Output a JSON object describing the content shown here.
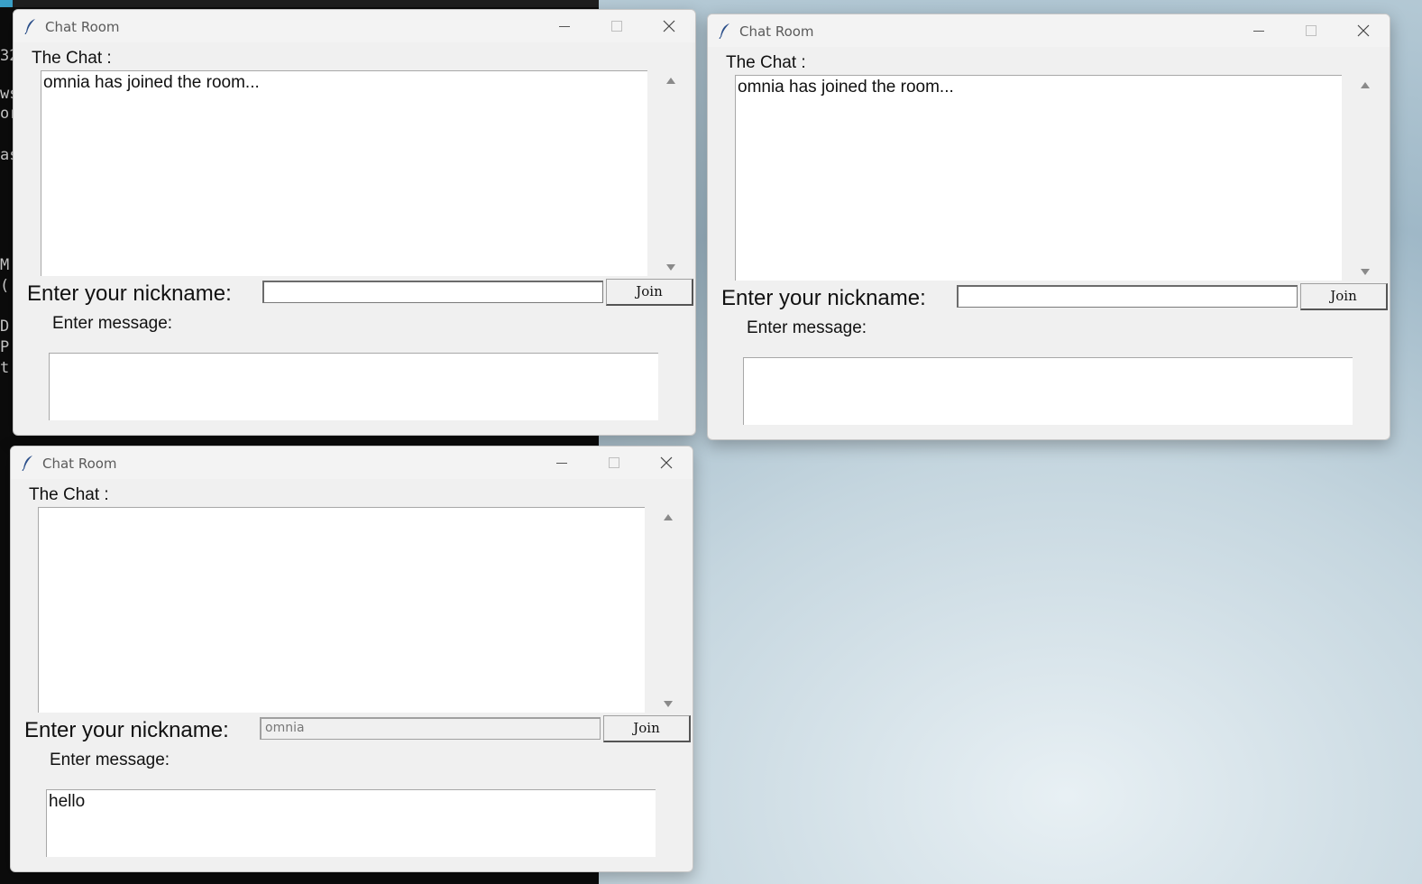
{
  "desktop": {
    "terminal_lines": [
      "32",
      "ws",
      "or",
      "",
      "as",
      "",
      "",
      "",
      "",
      "",
      "",
      "",
      "",
      "",
      "M",
      "(",
      "",
      "D",
      "P",
      "t"
    ]
  },
  "windows": [
    {
      "title": "Chat Room",
      "chat_label": "The Chat :",
      "chat_text": "omnia has joined the room...",
      "nickname_label": "Enter your nickname:",
      "nickname_value": "",
      "join_label": "Join",
      "message_label": "Enter message:",
      "message_value": ""
    },
    {
      "title": "Chat Room",
      "chat_label": "The Chat :",
      "chat_text": "omnia has joined the room...",
      "nickname_label": "Enter your nickname:",
      "nickname_value": "",
      "join_label": "Join",
      "message_label": "Enter message:",
      "message_value": ""
    },
    {
      "title": "Chat Room",
      "chat_label": "The Chat :",
      "chat_text": "",
      "nickname_label": "Enter your nickname:",
      "nickname_value": "omnia",
      "join_label": "Join",
      "message_label": "Enter message:",
      "message_value": "hello"
    }
  ]
}
